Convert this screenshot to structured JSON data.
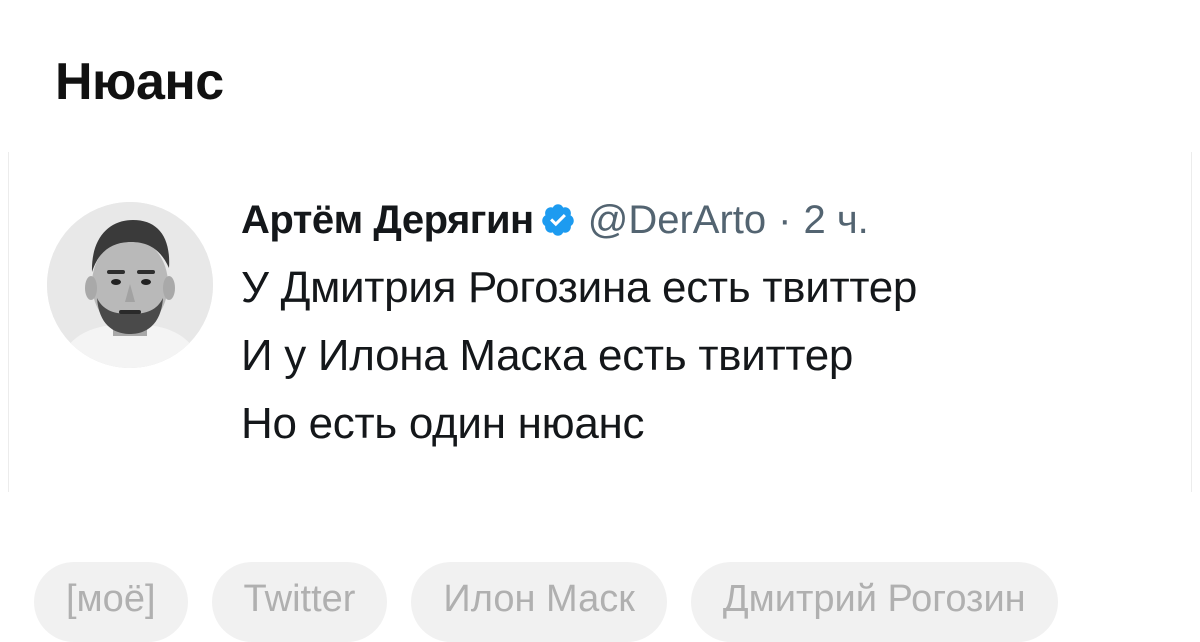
{
  "post": {
    "title": "Нюанс"
  },
  "tweet": {
    "author_name": "Артём Дерягин",
    "verified_icon": "verified-badge-icon",
    "handle": "@DerArto",
    "separator": "·",
    "timestamp": "2 ч.",
    "lines": [
      "У Дмитрия Рогозина есть твиттер",
      "И у Илона Маска есть твиттер",
      "Но есть один нюанс"
    ],
    "colors": {
      "verified": "#1d9bf0",
      "meta": "#536471",
      "text": "#14171a"
    }
  },
  "tags": [
    "[моё]",
    "Twitter",
    "Илон Маск",
    "Дмитрий Рогозин"
  ],
  "colors": {
    "tag_bg": "#f1f1f1",
    "tag_text": "#b0b0b0"
  }
}
